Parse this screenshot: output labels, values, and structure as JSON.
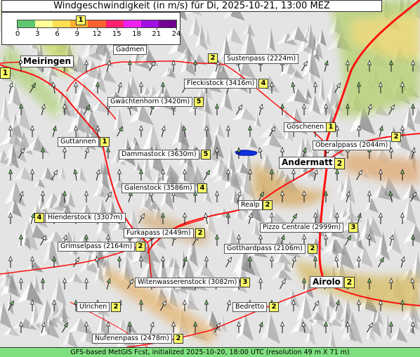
{
  "title": "Windgeschwindigkeit (in m/s) für Di, 2025-10-21, 13:00 MEZ",
  "legend": {
    "ticks": [
      "0",
      "3",
      "6",
      "9",
      "12",
      "15",
      "18",
      "21",
      "24"
    ],
    "colors": [
      "#5ec86e",
      "#ffff99",
      "#ffdd55",
      "#ffb030",
      "#ff6030",
      "#ff2070",
      "#ee20ee",
      "#a010e0",
      "#700090"
    ]
  },
  "places": [
    {
      "name": "Gadmen",
      "value": "1",
      "size": "small"
    },
    {
      "name": "Sustenpass (2224m)",
      "value": "2",
      "size": "small"
    },
    {
      "name": "Meiringen",
      "value": "1",
      "size": "big"
    },
    {
      "name": "Fleckistock (3416m)",
      "value": "4",
      "size": "small"
    },
    {
      "name": "Gwächtenhorn (3420m)",
      "value": "5",
      "size": "small"
    },
    {
      "name": "Göschenen",
      "value": "1",
      "size": "small"
    },
    {
      "name": "Oberalppass (2044m)",
      "value": "2",
      "size": "small"
    },
    {
      "name": "Guttannen",
      "value": "1",
      "size": "small"
    },
    {
      "name": "Dammastock (3630m)",
      "value": "5",
      "size": "small"
    },
    {
      "name": "Andermatt",
      "value": "2",
      "size": "big"
    },
    {
      "name": "Galenstock (3586m)",
      "value": "4",
      "size": "small"
    },
    {
      "name": "Realp",
      "value": "2",
      "size": "small"
    },
    {
      "name": "Hienderstock (3307m)",
      "value": "4",
      "size": "small"
    },
    {
      "name": "Pizzo Centrale (2999m)",
      "value": "3",
      "size": "small"
    },
    {
      "name": "Furkapass (2449m)",
      "value": "2",
      "size": "small"
    },
    {
      "name": "Grimselpass (2164m)",
      "value": "2",
      "size": "small"
    },
    {
      "name": "Gotthardpass (2106m)",
      "value": "2",
      "size": "small"
    },
    {
      "name": "Airolo",
      "value": "2",
      "size": "big"
    },
    {
      "name": "Witenwasserenstock (3082m)",
      "value": "3",
      "size": "small"
    },
    {
      "name": "Ulrichen",
      "value": "2",
      "size": "small"
    },
    {
      "name": "Bedretto",
      "value": "2",
      "size": "small"
    },
    {
      "name": "Nufenenpass (2478m)",
      "value": "2",
      "size": "small"
    }
  ],
  "footer": "GFS-based MetGIS Fcst, initialized 2025-10-20, 18:00 UTC  (resolution 49 m X 71 m)"
}
